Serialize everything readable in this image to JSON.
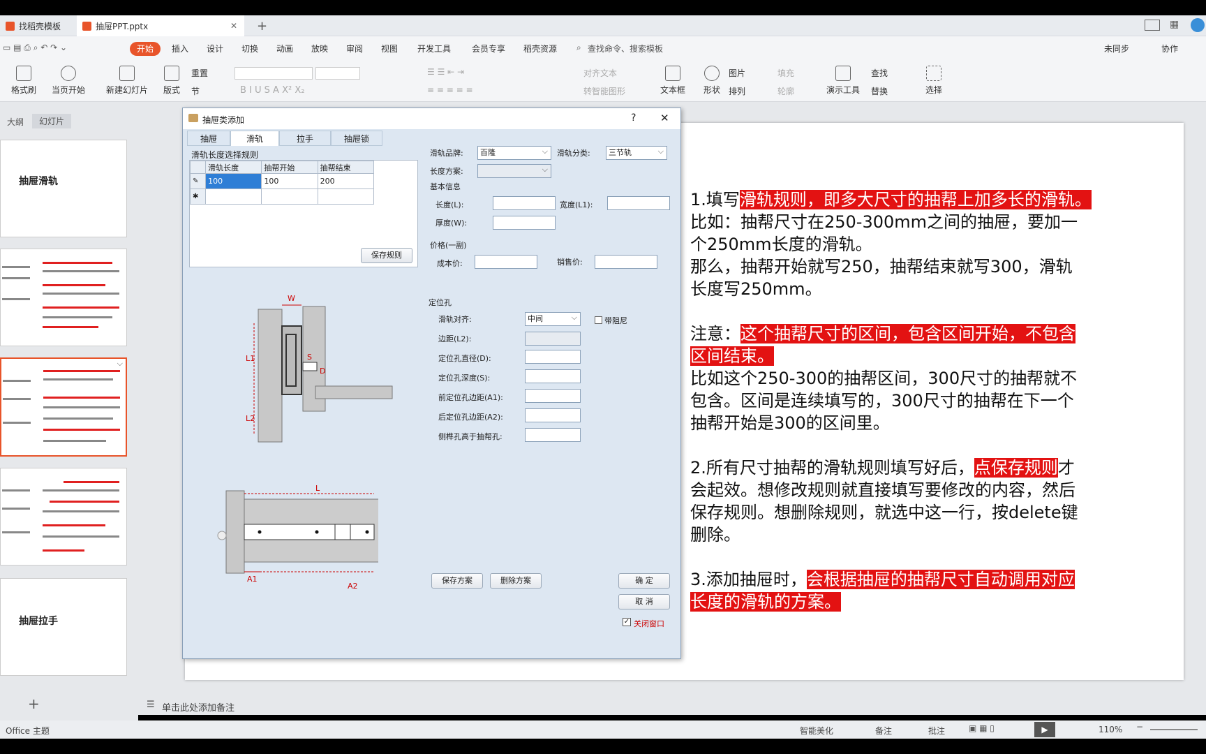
{
  "tabs": {
    "template": "找稻壳模板",
    "file": "抽屉PPT.pptx"
  },
  "menu": [
    "开始",
    "插入",
    "设计",
    "切换",
    "动画",
    "放映",
    "审阅",
    "视图",
    "开发工具",
    "会员专享",
    "稻壳资源"
  ],
  "search_placeholder": "查找命令、搜索模板",
  "sync": "未同步",
  "collab": "协作",
  "ribbon": {
    "format_painter": "格式刷",
    "from_current": "当页开始",
    "new_slide": "新建幻灯片",
    "layout": "版式",
    "reset": "重置",
    "section": "节",
    "align_text": "对齐文本",
    "smart_shape": "转智能图形",
    "textbox": "文本框",
    "shape": "形状",
    "picture": "图片",
    "arrange": "排列",
    "fill": "填充",
    "outline": "轮廓",
    "present_tools": "演示工具",
    "find": "查找",
    "replace": "替换",
    "select": "选择"
  },
  "panel": {
    "outline": "大纲",
    "slides": "幻灯片",
    "thumb1": "抽屉滑轨",
    "thumb5": "抽屉拉手"
  },
  "dialog": {
    "title": "抽屉类添加",
    "help": "?",
    "close": "✕",
    "tabs": [
      "抽屉",
      "滑轨",
      "拉手",
      "抽屉锁"
    ],
    "rule_title": "滑轨长度选择规则",
    "table_headers": [
      "滑轨长度",
      "抽帮开始",
      "抽帮结束"
    ],
    "table_rows": [
      [
        "100",
        "100",
        "200"
      ],
      [
        "",
        "",
        ""
      ]
    ],
    "save_rule": "保存规则",
    "brand_label": "滑轨品牌:",
    "brand_value": "百隆",
    "class_label": "滑轨分类:",
    "class_value": "三节轨",
    "length_scheme_label": "长度方案:",
    "basic_info": "基本信息",
    "length_label": "长度(L):",
    "width_label": "宽度(L1):",
    "thickness_label": "厚度(W):",
    "price_group": "价格(一副)",
    "cost_label": "成本价:",
    "sale_label": "销售价:",
    "hole_group": "定位孔",
    "align_label": "滑轨对齐:",
    "align_value": "中间",
    "damper_label": "带阻尼",
    "margin_label": "边距(L2):",
    "diameter_label": "定位孔直径(D):",
    "depth_label": "定位孔深度(S):",
    "front_margin_label": "前定位孔边距(A1):",
    "back_margin_label": "后定位孔边距(A2):",
    "side_label": "侧榫孔高于抽帮孔:",
    "save_scheme": "保存方案",
    "delete_scheme": "删除方案",
    "ok": "确 定",
    "cancel": "取 消",
    "close_window": "关闭窗口",
    "diagram": {
      "W": "W",
      "S": "S",
      "D": "D",
      "L1": "L1",
      "L2": "L2",
      "L": "L",
      "A1": "A1",
      "A2": "A2"
    }
  },
  "slide": {
    "l1a": "1.填写",
    "l1b": "滑轨规则，即多大尺寸的抽帮上加多长的滑轨。",
    "l2": "比如：抽帮尺寸在250-300mm之间的抽屉，要加一",
    "l3": "个250mm长度的滑轨。",
    "l4": "那么，抽帮开始就写250，抽帮结束就写300，滑轨",
    "l5": "长度写250mm。",
    "l6a": "注意：",
    "l6b": "这个抽帮尺寸的区间，包含区间开始，不包含",
    "l7": "区间结束。",
    "l8": "比如这个250-300的抽帮区间，300尺寸的抽帮就不",
    "l9": "包含。区间是连续填写的，300尺寸的抽帮在下一个",
    "l10": "抽帮开始是300的区间里。",
    "l11a": "2.所有尺寸抽帮的滑轨规则填写好后，",
    "l11b": "点保存规则",
    "l11c": "才",
    "l12": "会起效。想修改规则就直接填写要修改的内容，然后",
    "l13": "保存规则。想删除规则，就选中这一行，按delete键",
    "l14": "删除。",
    "l15a": "3.添加抽屉时，",
    "l15b": "会根据抽屉的抽帮尺寸自动调用对应",
    "l16": "长度的滑轨的方案。"
  },
  "notes": "单击此处添加备注",
  "status": {
    "theme": "Office 主题",
    "beautify": "智能美化",
    "notes": "备注",
    "comment": "批注",
    "zoom": "110%"
  }
}
